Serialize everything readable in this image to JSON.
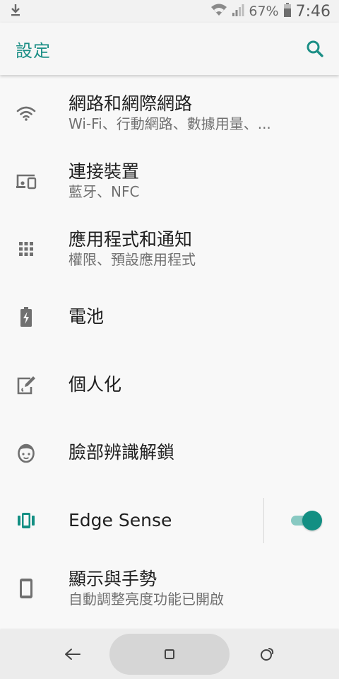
{
  "status_bar": {
    "download_icon": "download-icon",
    "wifi_icon": "wifi-icon",
    "signal_icon": "signal-icon",
    "battery_percent": "67%",
    "battery_icon": "battery-icon",
    "time": "7:46"
  },
  "app_bar": {
    "title": "設定",
    "search_icon": "search-icon"
  },
  "settings": [
    {
      "icon": "wifi-icon",
      "title": "網路和網際網路",
      "subtitle": "Wi-Fi、行動網路、數據用量、..."
    },
    {
      "icon": "devices-icon",
      "title": "連接裝置",
      "subtitle": "藍牙、NFC"
    },
    {
      "icon": "apps-grid-icon",
      "title": "應用程式和通知",
      "subtitle": "權限、預設應用程式"
    },
    {
      "icon": "battery-charging-icon",
      "title": "電池",
      "subtitle": ""
    },
    {
      "icon": "personalize-icon",
      "title": "個人化",
      "subtitle": ""
    },
    {
      "icon": "face-icon",
      "title": "臉部辨識解鎖",
      "subtitle": ""
    },
    {
      "icon": "edge-sense-icon",
      "title": "Edge Sense",
      "subtitle": "",
      "toggle_on": true
    },
    {
      "icon": "phone-display-icon",
      "title": "顯示與手勢",
      "subtitle": "自動調整亮度功能已開啟"
    }
  ],
  "nav_bar": {
    "back_icon": "back-icon",
    "home_icon": "home-icon",
    "recents_icon": "recents-icon"
  },
  "colors": {
    "accent": "#1c8f86",
    "toggle_knob": "#138f83",
    "toggle_track": "#88c9c2"
  }
}
